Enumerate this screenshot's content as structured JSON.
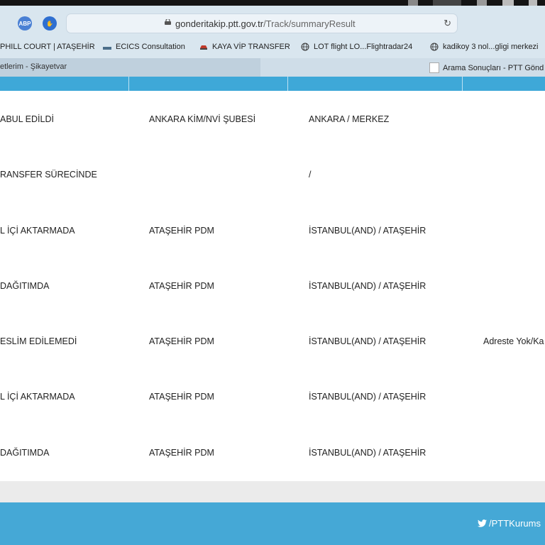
{
  "browser": {
    "url_host": "gonderitakip.ptt.gov.tr",
    "url_path": "/Track/summaryResult",
    "extensions": [
      {
        "name": "adblock-plus-icon",
        "label": "ABP"
      },
      {
        "name": "stop-hand-icon",
        "label": "✋"
      }
    ]
  },
  "bookmarks": [
    {
      "label": "PHILL COURT | ATAŞEHİR",
      "icon": "none"
    },
    {
      "label": "ECICS Consultation",
      "icon": "ecics-icon"
    },
    {
      "label": "KAYA VİP TRANSFER",
      "icon": "car-icon"
    },
    {
      "label": "LOT flight LO...Flightradar24",
      "icon": "globe-icon"
    },
    {
      "label": "kadikoy 3 nol...gligi merkezi",
      "icon": "globe-icon"
    }
  ],
  "tabs": [
    {
      "label": "etlerim - Şikayetvar"
    },
    {
      "label": "Arama Sonuçları - PTT Gönd"
    }
  ],
  "table": {
    "rows": [
      {
        "status": "ABUL EDİLDİ",
        "branch": "ANKARA KİM/NVİ ŞUBESİ",
        "location": "ANKARA / MERKEZ",
        "note": ""
      },
      {
        "status": "RANSFER SÜRECİNDE",
        "branch": "",
        "location": "/",
        "note": ""
      },
      {
        "status": "L İÇİ AKTARMADA",
        "branch": "ATAŞEHİR PDM",
        "location": "İSTANBUL(AND) / ATAŞEHİR",
        "note": ""
      },
      {
        "status": "DAĞITIMDA",
        "branch": "ATAŞEHİR PDM",
        "location": "İSTANBUL(AND) / ATAŞEHİR",
        "note": ""
      },
      {
        "status": "ESLİM EDİLEMEDİ",
        "branch": "ATAŞEHİR PDM",
        "location": "İSTANBUL(AND) / ATAŞEHİR",
        "note": "Adreste Yok/Ka"
      },
      {
        "status": "L İÇİ AKTARMADA",
        "branch": "ATAŞEHİR PDM",
        "location": "İSTANBUL(AND) / ATAŞEHİR",
        "note": ""
      },
      {
        "status": "DAĞITIMDA",
        "branch": "ATAŞEHİR PDM",
        "location": "İSTANBUL(AND) / ATAŞEHİR",
        "note": ""
      }
    ]
  },
  "footer": {
    "twitter_handle": "/PTTKurums",
    "color": "#45a8d6"
  },
  "colors": {
    "header_bar": "#3ea8d8",
    "browser_chrome": "#d9e6ef"
  }
}
